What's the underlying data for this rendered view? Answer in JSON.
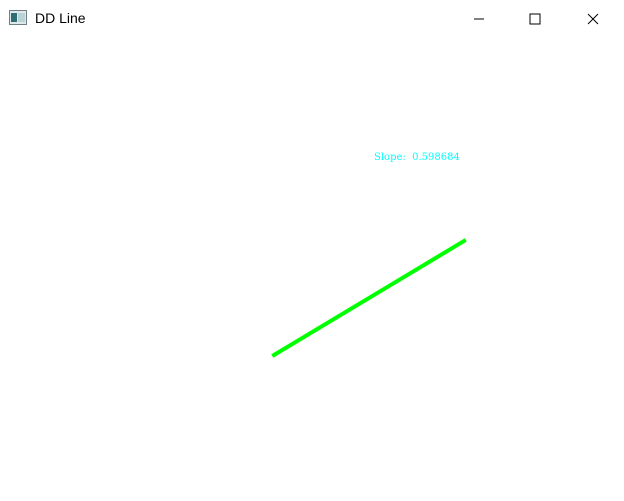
{
  "window": {
    "title": "DD Line",
    "icon": "window-app-icon",
    "controls": [
      "minimize-icon",
      "maximize-icon",
      "close-icon"
    ]
  },
  "canvas": {
    "background": "#ffffff",
    "slope_label": "Slope:  0.598684",
    "line": {
      "color": "#00ff00",
      "description_icon": "dda-line"
    }
  }
}
